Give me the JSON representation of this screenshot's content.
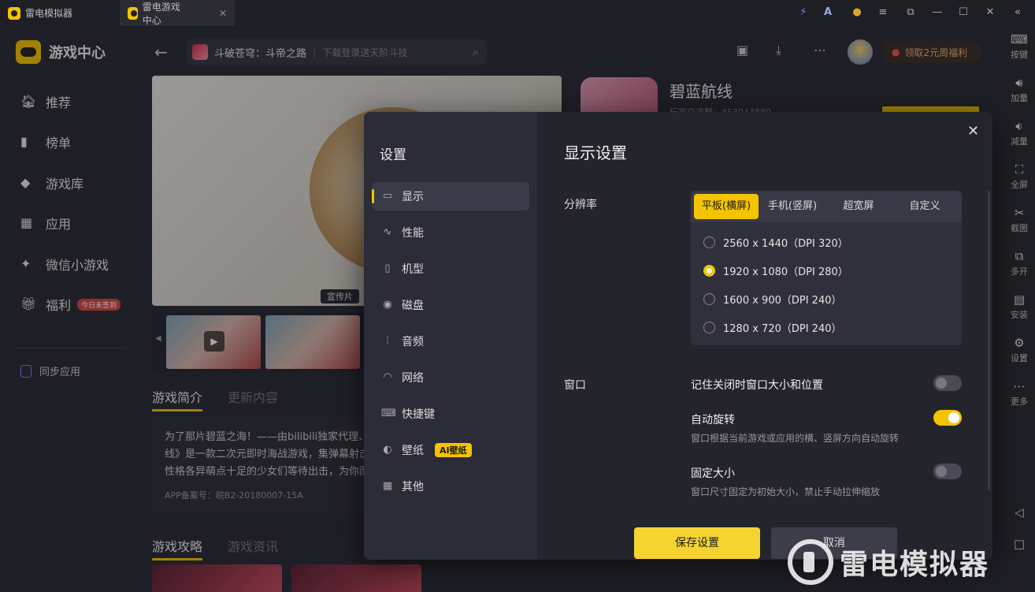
{
  "titlebar": {
    "tabs": [
      {
        "label": "雷电模拟器"
      },
      {
        "label": "雷电游戏中心"
      }
    ]
  },
  "sidebar": {
    "logo_text": "游戏中心",
    "items": [
      {
        "label": "推荐"
      },
      {
        "label": "榜单"
      },
      {
        "label": "游戏库"
      },
      {
        "label": "应用"
      },
      {
        "label": "微信小游戏"
      },
      {
        "label": "福利",
        "badge": "今日未签到"
      }
    ],
    "sync_label": "同步应用"
  },
  "topbar": {
    "search_game": "斗破苍穹：斗帝之路",
    "search_placeholder": "下载登录送天阶斗技",
    "promo": "领取2元周福利"
  },
  "rightbar": {
    "items": [
      "按键",
      "加量",
      "减量",
      "全屏",
      "截图",
      "多开",
      "安装",
      "设置",
      "更多"
    ]
  },
  "background": {
    "promo_tag": "宣传片",
    "tabs": [
      "游戏简介",
      "更新内容"
    ],
    "desc_lines": [
      "为了那片碧蓝之海！——由bilibili独家代理、蛮",
      "线》是一款二次元即时海战游戏，集弹幕射击",
      "性格各异萌点十足的少女们等待出击，为你而"
    ],
    "icp": "APP备案号：皖B2-20180007-15A",
    "guide_tabs": [
      "游戏攻略",
      "游戏资讯"
    ],
    "game_name": "碧蓝航线",
    "game_sub": "玩家交流群：453043880"
  },
  "modal": {
    "side_title": "设置",
    "menu": [
      {
        "label": "显示",
        "icon": "monitor-icon"
      },
      {
        "label": "性能",
        "icon": "pulse-icon"
      },
      {
        "label": "机型",
        "icon": "phone-icon"
      },
      {
        "label": "磁盘",
        "icon": "disk-icon"
      },
      {
        "label": "音频",
        "icon": "audio-icon"
      },
      {
        "label": "网络",
        "icon": "wifi-icon"
      },
      {
        "label": "快捷键",
        "icon": "keyboard-icon"
      },
      {
        "label": "壁纸",
        "icon": "palette-icon",
        "badge": "AI壁纸"
      },
      {
        "label": "其他",
        "icon": "grid-icon"
      }
    ],
    "heading": "显示设置",
    "resolution_label": "分辨率",
    "modes": [
      "平板(横屏)",
      "手机(竖屏)",
      "超宽屏",
      "自定义"
    ],
    "selected_mode": "平板(横屏)",
    "resolutions": [
      {
        "label": "2560 x 1440（DPI 320）",
        "selected": false
      },
      {
        "label": "1920 x 1080（DPI 280）",
        "selected": true
      },
      {
        "label": "1600 x 900（DPI 240）",
        "selected": false
      },
      {
        "label": "1280 x 720（DPI 240）",
        "selected": false
      }
    ],
    "window_label": "窗口",
    "options": [
      {
        "title": "记住关闭时窗口大小和位置",
        "sub": "",
        "on": false
      },
      {
        "title": "自动旋转",
        "sub": "窗口根据当前游戏或应用的横、竖屏方向自动旋转",
        "on": true
      },
      {
        "title": "固定大小",
        "sub": "窗口尺寸固定为初始大小，禁止手动拉伸缩放",
        "on": false
      }
    ],
    "save_label": "保存设置",
    "cancel_label": "取消"
  },
  "watermark": "雷电模拟器",
  "colors": {
    "accent": "#f5c400",
    "bg": "#2a2b33",
    "modal": "#23242c"
  }
}
